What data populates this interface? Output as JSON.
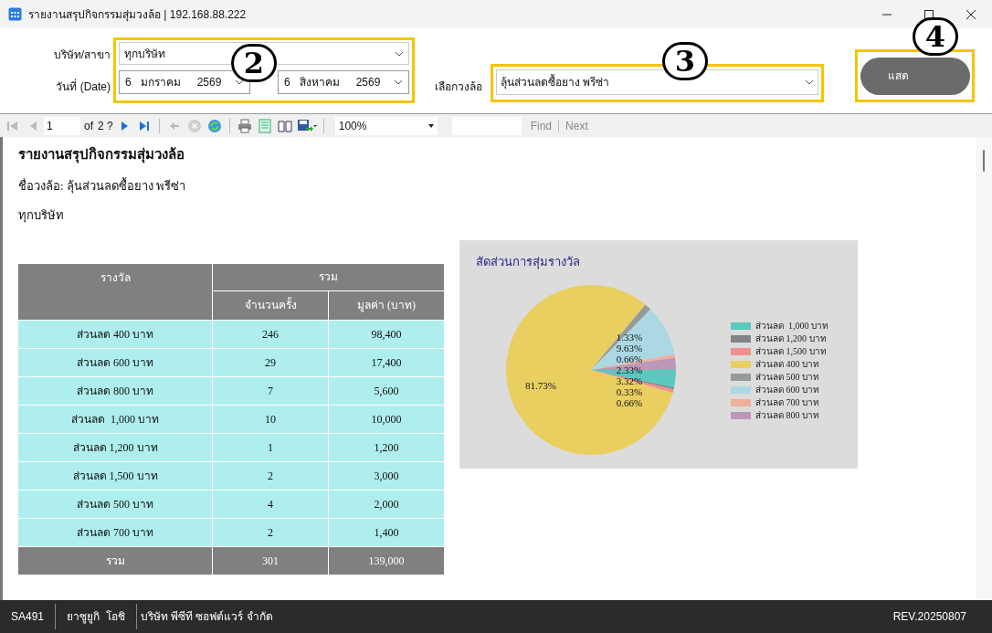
{
  "window": {
    "title": "รายงานสรุปกิจกรรมสุ่มวงล้อ | 192.168.88.222"
  },
  "filters": {
    "company": {
      "label": "บริษัท/สาขา",
      "value": "ทุกบริษัท"
    },
    "date": {
      "label": "วันที่ (Date)",
      "from": {
        "day": "6",
        "month": "มกราคม",
        "year": "2569"
      },
      "to": {
        "day": "6",
        "month": "สิงหาคม",
        "year": "2569"
      }
    },
    "wheel": {
      "label": "เลือกวงล้อ",
      "value": "ลุ้นส่วนลดซื้อยาง พรีซ่า"
    },
    "show_button": {
      "label": "แสด"
    }
  },
  "callouts": [
    "2",
    "3",
    "4"
  ],
  "toolbar": {
    "nav_buttons": [
      {
        "kind": "first",
        "disabled": true
      },
      {
        "kind": "prev",
        "disabled": true
      }
    ],
    "page": "1",
    "of": "of",
    "total": "2 ?",
    "nav_after": [
      {
        "kind": "next",
        "disabled": false
      },
      {
        "kind": "last",
        "disabled": false
      }
    ],
    "actions": [
      {
        "kind": "back",
        "disabled": true
      },
      {
        "kind": "stop",
        "disabled": true
      },
      {
        "kind": "refresh",
        "disabled": false
      }
    ],
    "zoom": "100%",
    "find": "Find",
    "next": "Next"
  },
  "report": {
    "title": "รายงานสรุปกิจกรรมสุ่มวงล้อ",
    "wheel_line": "ชื่อวงล้อ: ลุ้นส่วนลดซื้อยาง พรีซ่า",
    "company_line": "ทุกบริษัท",
    "table": {
      "header": {
        "prize": "รางวัล",
        "total": "รวม",
        "count": "จำนวนครั้ง",
        "value": "มูลค่า (บาท)"
      },
      "rows": [
        {
          "prize": "ส่วนลด 400 บาท",
          "count": "246",
          "value": "98,400"
        },
        {
          "prize": "ส่วนลด 600 บาท",
          "count": "29",
          "value": "17,400"
        },
        {
          "prize": "ส่วนลด 800 บาท",
          "count": "7",
          "value": "5,600"
        },
        {
          "prize": "ส่วนลด  1,000 บาท",
          "count": "10",
          "value": "10,000"
        },
        {
          "prize": "ส่วนลด 1,200 บาท",
          "count": "1",
          "value": "1,200"
        },
        {
          "prize": "ส่วนลด 1,500 บาท",
          "count": "2",
          "value": "3,000"
        },
        {
          "prize": "ส่วนลด 500 บาท",
          "count": "4",
          "value": "2,000"
        },
        {
          "prize": "ส่วนลด 700 บาท",
          "count": "2",
          "value": "1,400"
        }
      ],
      "footer": {
        "prize": "รวม",
        "count": "301",
        "value": "139,000"
      }
    },
    "chart": {
      "chart_data": {
        "type": "pie",
        "title": "สัดส่วนการสุ่มรางวัล",
        "categories": [
          "ส่วนลด  1,000 บาท",
          "ส่วนลด 1,200 บาท",
          "ส่วนลด 1,500 บาท",
          "ส่วนลด 400 บาท",
          "ส่วนลด 500 บาท",
          "ส่วนลด 600 บาท",
          "ส่วนลด 700 บาท",
          "ส่วนลด 800 บาท"
        ],
        "legend": "right",
        "series": [
          {
            "colors": [
              "#5bc8bf",
              "#7f8487",
              "#f0908f",
              "#e9cf60",
              "#959a9a",
              "#acd8e4",
              "#f0b09a",
              "#bb98b5"
            ],
            "values": [
              3.32,
              0.33,
              0.66,
              81.73,
              1.33,
              9.63,
              0.66,
              2.33
            ]
          }
        ],
        "value_labels": [
          "3.32%",
          "0.33%",
          "0.66%",
          "81.73%",
          "1.33%",
          "9.63%",
          "0.66%",
          "2.33%"
        ]
      }
    }
  },
  "status_bar": {
    "items": [
      "SA491",
      "ยาซูยูกิ  โอชิ",
      "บริษัท พีซีที ซอฟต์แวร์ จำกัด"
    ],
    "revision": "REV.20250807"
  }
}
